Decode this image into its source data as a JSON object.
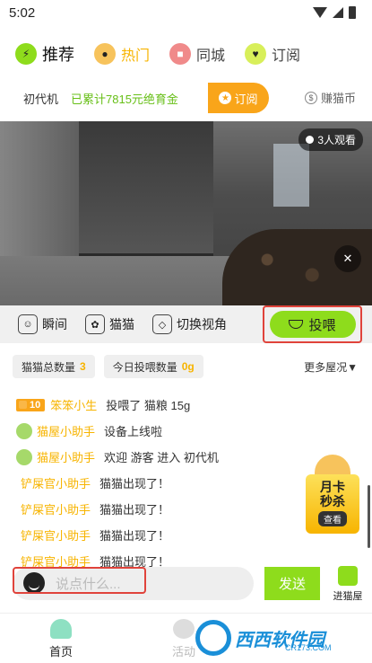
{
  "status": {
    "time": "5:02"
  },
  "tabs": [
    {
      "label": "推荐",
      "icon": "lightning-icon",
      "active": true
    },
    {
      "label": "热门",
      "icon": "fire-icon",
      "active": false
    },
    {
      "label": "同城",
      "icon": "location-icon",
      "active": false
    },
    {
      "label": "订阅",
      "icon": "heart-icon",
      "active": false
    }
  ],
  "info": {
    "machine_name": "初代机",
    "funds": "已累计7815元绝育金",
    "subscribe": "订阅",
    "earn": "赚猫币"
  },
  "video": {
    "viewers": "3人观看"
  },
  "actions": {
    "moment": "瞬间",
    "cats": "猫猫",
    "switch_view": "切换视角",
    "feed": "投喂"
  },
  "stats": {
    "cat_total_label": "猫猫总数量",
    "cat_total_value": "3",
    "feed_today_label": "今日投喂数量",
    "feed_today_value": "0g",
    "more": "更多屋况▼"
  },
  "messages": [
    {
      "badge": "10",
      "user": "笨笨小生",
      "text": "投喂了 猫粮 15g",
      "kind": "user"
    },
    {
      "user": "猫屋小助手",
      "text": "设备上线啦",
      "kind": "assistant"
    },
    {
      "user": "猫屋小助手",
      "text": "欢迎 游客 进入 初代机",
      "kind": "assistant"
    },
    {
      "user": "铲屎官小助手",
      "text": "猫猫出现了！",
      "kind": "sys"
    },
    {
      "user": "铲屎官小助手",
      "text": "猫猫出现了！",
      "kind": "sys"
    },
    {
      "user": "铲屎官小助手",
      "text": "猫猫出现了！",
      "kind": "sys"
    },
    {
      "user": "铲屎官小助手",
      "text": "猫猫出现了！",
      "kind": "sys"
    }
  ],
  "promo": {
    "line1": "月卡",
    "line2": "秒杀",
    "button": "查看"
  },
  "chat": {
    "placeholder": "说点什么...",
    "send": "发送",
    "enter_house": "进猫屋"
  },
  "nav": {
    "home": "首页",
    "activity": "活动"
  },
  "watermark": {
    "brand": "西西软件园",
    "url": "CR173.COM"
  },
  "colors": {
    "accent_green": "#8edc1c",
    "accent_orange": "#f9a51a",
    "highlight_red": "#e0433b",
    "username_yellow": "#f7b400"
  }
}
